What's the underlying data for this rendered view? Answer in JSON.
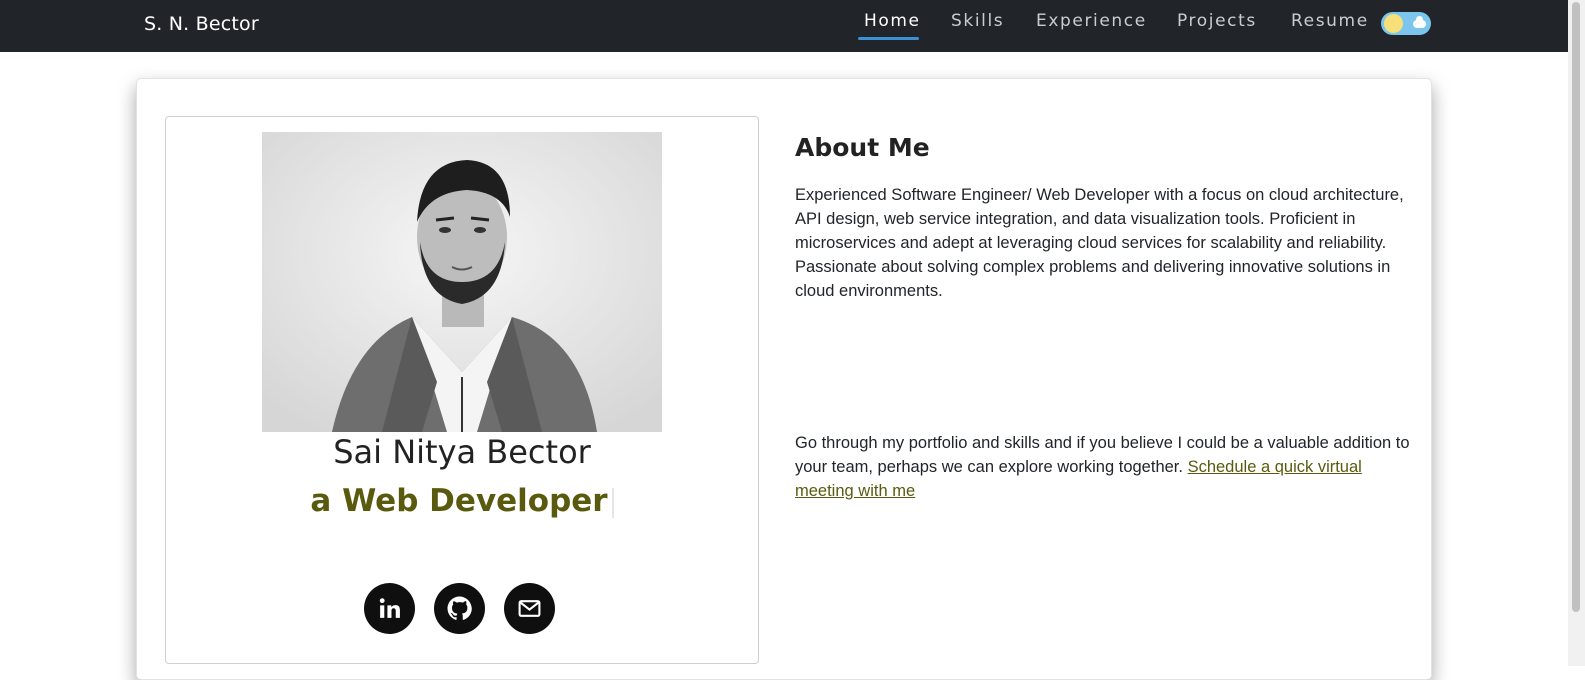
{
  "navbar": {
    "brand": "S. N. Bector",
    "items": [
      {
        "label": "Home",
        "active": true
      },
      {
        "label": "Skills",
        "active": false
      },
      {
        "label": "Experience",
        "active": false
      },
      {
        "label": "Projects",
        "active": false
      },
      {
        "label": "Resume",
        "active": false
      }
    ],
    "theme_toggle": {
      "icons": [
        "sun-icon",
        "cloud-icon"
      ],
      "mode": "light"
    },
    "accent_color": "#3d8fd6"
  },
  "profile": {
    "name": "Sai Nitya Bector",
    "role": "a Web Developer",
    "role_color": "#5a5a0f",
    "photo": "portrait-photo",
    "social": [
      {
        "icon": "linkedin-icon"
      },
      {
        "icon": "github-icon"
      },
      {
        "icon": "mail-icon"
      }
    ]
  },
  "about": {
    "title": "About Me",
    "paragraph": "Experienced Software Engineer/ Web Developer with a focus on cloud architecture, API design, web service integration, and data visualization tools. Proficient in microservices and adept at leveraging cloud services for scalability and reliability. Passionate about solving complex problems and delivering innovative solutions in cloud environments.",
    "cta_text": "Go through my portfolio and skills and if you believe I could be a valuable addition to your team, perhaps we can explore working together. ",
    "cta_link": "Schedule a quick virtual meeting with me"
  }
}
